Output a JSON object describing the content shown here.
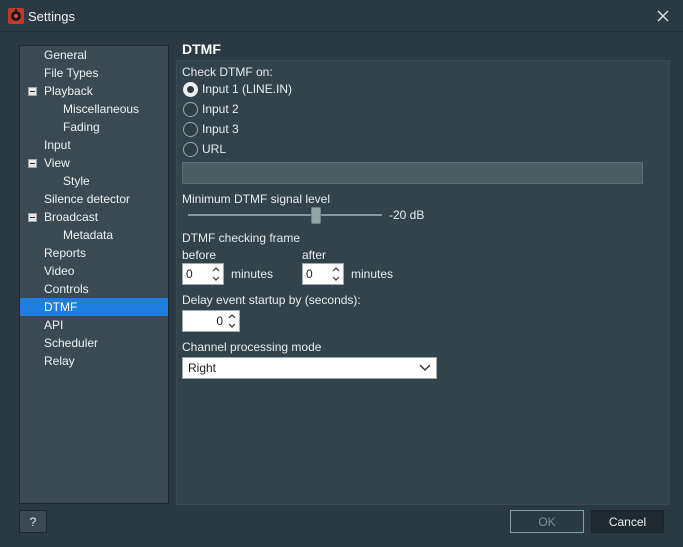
{
  "window": {
    "title": "Settings"
  },
  "sidebar": {
    "items": [
      {
        "label": "General",
        "level": 0
      },
      {
        "label": "File Types",
        "level": 0
      },
      {
        "label": "Playback",
        "level": 0,
        "expanded": true
      },
      {
        "label": "Miscellaneous",
        "level": 1
      },
      {
        "label": "Fading",
        "level": 1
      },
      {
        "label": "Input",
        "level": 0
      },
      {
        "label": "View",
        "level": 0,
        "expanded": true
      },
      {
        "label": "Style",
        "level": 1
      },
      {
        "label": "Silence detector",
        "level": 0
      },
      {
        "label": "Broadcast",
        "level": 0,
        "expanded": true
      },
      {
        "label": "Metadata",
        "level": 1
      },
      {
        "label": "Reports",
        "level": 0
      },
      {
        "label": "Video",
        "level": 0
      },
      {
        "label": "Controls",
        "level": 0
      },
      {
        "label": "DTMF",
        "level": 0,
        "selected": true
      },
      {
        "label": "API",
        "level": 0
      },
      {
        "label": "Scheduler",
        "level": 0
      },
      {
        "label": "Relay",
        "level": 0
      }
    ]
  },
  "dtmf": {
    "title": "DTMF",
    "check_on_label": "Check DTMF on:",
    "inputs": [
      {
        "label": "Input 1 (LINE.IN)",
        "checked": true
      },
      {
        "label": "Input 2",
        "checked": false
      },
      {
        "label": "Input 3",
        "checked": false
      },
      {
        "label": "URL",
        "checked": false
      }
    ],
    "url_value": "",
    "min_level_label": "Minimum DTMF signal level",
    "min_level_value_text": "-20 dB",
    "min_level_fraction": 0.66,
    "frame_label": "DTMF checking frame",
    "before_label": "before",
    "after_label": "after",
    "before_value": "0",
    "after_value": "0",
    "minutes_label": "minutes",
    "delay_label": "Delay event startup by (seconds):",
    "delay_value": "0",
    "channel_mode_label": "Channel processing mode",
    "channel_mode_value": "Right"
  },
  "buttons": {
    "help": "?",
    "ok": "OK",
    "cancel": "Cancel"
  },
  "colors": {
    "background": "#2b3a42",
    "selection": "#1f7fdf",
    "ok_border": "#6fa7ac"
  },
  "icons": {
    "app": "app-settings-icon",
    "close": "close-icon",
    "expander": "collapse-icon",
    "dropdown": "chevron-down-icon"
  }
}
